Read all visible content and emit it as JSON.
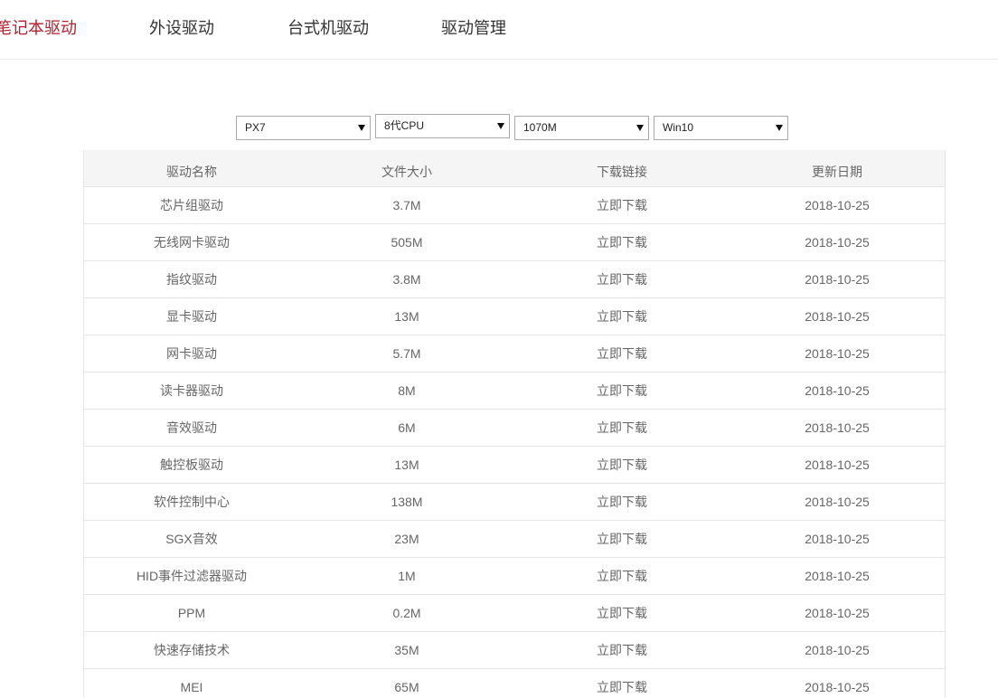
{
  "nav": {
    "tabs": [
      {
        "label": "笔记本驱动",
        "active": true
      },
      {
        "label": "外设驱动",
        "active": false
      },
      {
        "label": "台式机驱动",
        "active": false
      },
      {
        "label": "驱动管理",
        "active": false
      }
    ]
  },
  "filters": {
    "model": {
      "value": "PX7",
      "icon": "chevron-down-icon"
    },
    "cpu": {
      "value": "8代CPU",
      "icon": "chevron-down-icon"
    },
    "gpu": {
      "value": "1070M",
      "icon": "chevron-down-icon"
    },
    "os": {
      "value": "Win10",
      "icon": "chevron-down-icon"
    }
  },
  "table": {
    "headers": [
      "驱动名称",
      "文件大小",
      "下载链接",
      "更新日期"
    ],
    "rows": [
      {
        "name": "芯片组驱动",
        "size": "3.7M",
        "link": "立即下载",
        "date": "2018-10-25"
      },
      {
        "name": "无线网卡驱动",
        "size": "505M",
        "link": "立即下载",
        "date": "2018-10-25"
      },
      {
        "name": "指纹驱动",
        "size": "3.8M",
        "link": "立即下载",
        "date": "2018-10-25"
      },
      {
        "name": "显卡驱动",
        "size": "13M",
        "link": "立即下载",
        "date": "2018-10-25"
      },
      {
        "name": "网卡驱动",
        "size": "5.7M",
        "link": "立即下载",
        "date": "2018-10-25"
      },
      {
        "name": "读卡器驱动",
        "size": "8M",
        "link": "立即下载",
        "date": "2018-10-25"
      },
      {
        "name": "音效驱动",
        "size": "6M",
        "link": "立即下载",
        "date": "2018-10-25"
      },
      {
        "name": "触控板驱动",
        "size": "13M",
        "link": "立即下载",
        "date": "2018-10-25"
      },
      {
        "name": "软件控制中心",
        "size": "138M",
        "link": "立即下载",
        "date": "2018-10-25"
      },
      {
        "name": "SGX音效",
        "size": "23M",
        "link": "立即下载",
        "date": "2018-10-25"
      },
      {
        "name": "HID事件过滤器驱动",
        "size": "1M",
        "link": "立即下载",
        "date": "2018-10-25"
      },
      {
        "name": "PPM",
        "size": "0.2M",
        "link": "立即下载",
        "date": "2018-10-25"
      },
      {
        "name": "快速存储技术",
        "size": "35M",
        "link": "立即下载",
        "date": "2018-10-25"
      },
      {
        "name": "MEI",
        "size": "65M",
        "link": "立即下载",
        "date": "2018-10-25"
      }
    ]
  },
  "colors": {
    "accent": "#b41e2d",
    "tab_text": "#333333",
    "cell_text": "#666666",
    "header_bg": "#f5f5f5",
    "border": "#e5e5e5",
    "select_border": "#a9a9a9"
  }
}
